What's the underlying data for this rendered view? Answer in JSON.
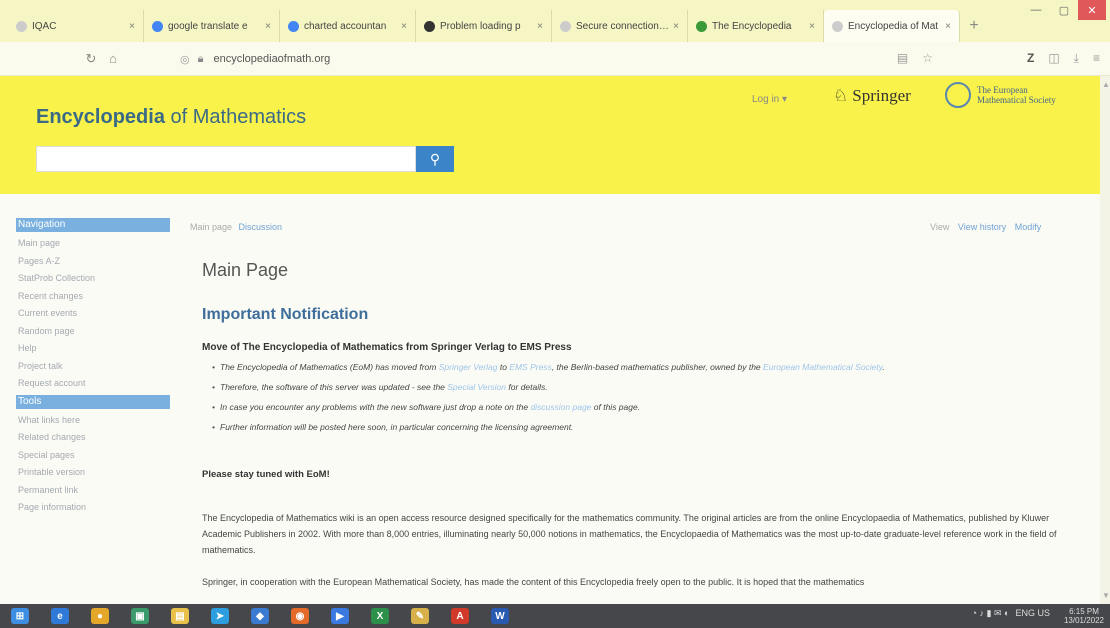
{
  "browser": {
    "tabs": [
      {
        "title": "IQAC",
        "icon_color": "#cccccc",
        "active": false
      },
      {
        "title": "google translate e",
        "icon_color": "#4285f4",
        "active": false
      },
      {
        "title": "charted accountan",
        "icon_color": "#4285f4",
        "active": false
      },
      {
        "title": "Problem loading p",
        "icon_color": "#333333",
        "active": false
      },
      {
        "title": "Secure connection fail",
        "icon_color": "#cccccc",
        "active": false
      },
      {
        "title": "The Encyclopedia",
        "icon_color": "#3a9a3a",
        "active": false
      },
      {
        "title": "Encyclopedia of Mat",
        "icon_color": "#cccccc",
        "active": true
      }
    ],
    "url": "encyclopediaofmath.org",
    "close_glyph": "×",
    "new_tab_glyph": "+"
  },
  "header": {
    "title_bold": "Encyclopedia",
    "title_rest": " of Mathematics",
    "search_placeholder": "",
    "login_label": "Log in ▾",
    "springer_label": "Springer",
    "ems_line1": "The European",
    "ems_line2": "Mathematical Society"
  },
  "sidebar": {
    "navigation_heading": "Navigation",
    "navigation_items": [
      "Main page",
      "Pages A-Z",
      "StatProb Collection",
      "Recent changes",
      "Current events",
      "Random page",
      "Help",
      "Project talk",
      "Request account"
    ],
    "tools_heading": "Tools",
    "tools_items": [
      "What links here",
      "Related changes",
      "Special pages",
      "Printable version",
      "Permanent link",
      "Page information"
    ]
  },
  "content": {
    "tab_main": "Main page",
    "tab_discussion": "Discussion",
    "tab_view": "View",
    "tab_history": "View history",
    "tab_modify": "Modify",
    "page_title": "Main Page",
    "notification_heading": "Important Notification",
    "move_heading": "Move of The Encyclopedia of Mathematics from Springer Verlag to EMS Press",
    "notes": {
      "n1_a": "The Encyclopedia of Mathematics (EoM) has moved from ",
      "n1_link1": "Springer Verlag",
      "n1_b": " to ",
      "n1_link2": "EMS Press",
      "n1_c": ", the Berlin-based mathematics publisher, owned by the ",
      "n1_link3": "European Mathematical Society",
      "n1_d": ".",
      "n2_a": "Therefore, the software of this server was updated - see the ",
      "n2_link": "Special Version",
      "n2_b": " for details.",
      "n3_a": "In case you encounter any problems with the new software just drop a note on the ",
      "n3_link": "discussion page",
      "n3_b": " of this page.",
      "n4": "Further information will be posted here soon, in particular concerning the licensing agreement."
    },
    "stay_tuned": "Please stay tuned with EoM!",
    "para1": "The Encyclopedia of Mathematics wiki is an open access resource designed specifically for the mathematics community. The original articles are from the online Encyclopaedia of Mathematics, published by Kluwer Academic Publishers in 2002. With more than 8,000 entries, illuminating nearly 50,000 notions in mathematics, the Encyclopaedia of Mathematics was the most up-to-date graduate-level reference work in the field of mathematics.",
    "para2": "Springer, in cooperation with the European Mathematical Society, has made the content of this Encyclopedia freely open to the public. It is hoped that the mathematics"
  },
  "taskbar": {
    "apps": [
      {
        "name": "start",
        "color": "#3d8ee0",
        "glyph": "⊞"
      },
      {
        "name": "edge",
        "color": "#2f7ad8",
        "glyph": "e"
      },
      {
        "name": "chrome",
        "color": "#e4a72a",
        "glyph": "●"
      },
      {
        "name": "store",
        "color": "#3a9a6a",
        "glyph": "▣"
      },
      {
        "name": "explorer",
        "color": "#e8c04a",
        "glyph": "▤"
      },
      {
        "name": "telegram",
        "color": "#2d9ee0",
        "glyph": "➤"
      },
      {
        "name": "app7",
        "color": "#3a7ad0",
        "glyph": "◆"
      },
      {
        "name": "firefox",
        "color": "#e46a2a",
        "glyph": "◉"
      },
      {
        "name": "zoom",
        "color": "#3a7ae0",
        "glyph": "▶"
      },
      {
        "name": "excel",
        "color": "#2c8f4a",
        "glyph": "X"
      },
      {
        "name": "paint",
        "color": "#d8b04a",
        "glyph": "✎"
      },
      {
        "name": "acrobat",
        "color": "#d03a2a",
        "glyph": "A"
      },
      {
        "name": "word",
        "color": "#2a5ab0",
        "glyph": "W"
      }
    ],
    "tray_text": "ENG US",
    "time": "6:15 PM",
    "date": "13/01/2022"
  }
}
